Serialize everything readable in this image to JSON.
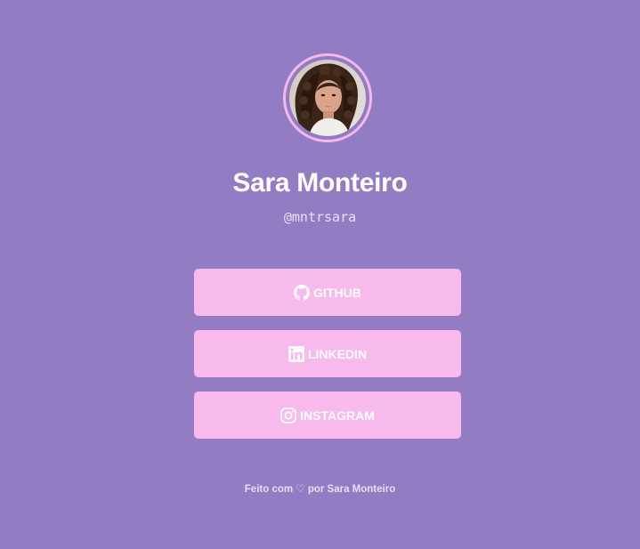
{
  "profile": {
    "name": "Sara Monteiro",
    "handle": "@mntrsara"
  },
  "links": {
    "github": {
      "label": "GITHUB",
      "icon": "github-icon"
    },
    "linkedin": {
      "label": "LINKEDIN",
      "icon": "linkedin-icon"
    },
    "instagram": {
      "label": "INSTAGRAM",
      "icon": "instagram-icon"
    }
  },
  "footer": {
    "prefix": "Feito com",
    "heart": "♡",
    "suffix": "por Sara Monteiro"
  },
  "colors": {
    "background": "#927CC4",
    "button": "#F8B9EC",
    "avatar_ring": "#F7B7EA",
    "text": "#FFFFFF"
  }
}
